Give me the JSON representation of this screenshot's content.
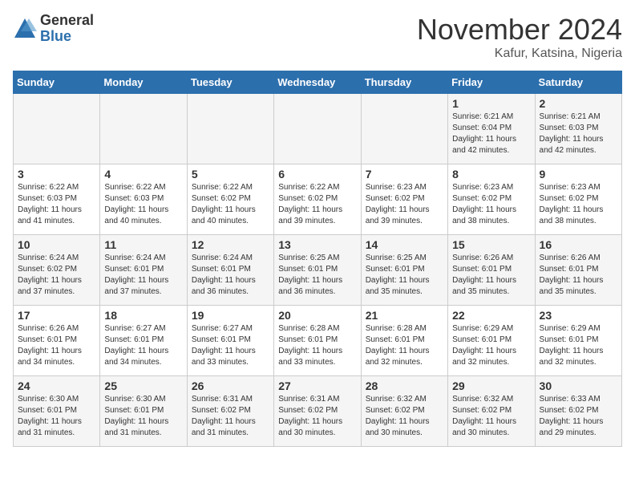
{
  "header": {
    "logo_general": "General",
    "logo_blue": "Blue",
    "month_title": "November 2024",
    "location": "Kafur, Katsina, Nigeria"
  },
  "weekdays": [
    "Sunday",
    "Monday",
    "Tuesday",
    "Wednesday",
    "Thursday",
    "Friday",
    "Saturday"
  ],
  "weeks": [
    [
      {
        "day": "",
        "info": ""
      },
      {
        "day": "",
        "info": ""
      },
      {
        "day": "",
        "info": ""
      },
      {
        "day": "",
        "info": ""
      },
      {
        "day": "",
        "info": ""
      },
      {
        "day": "1",
        "info": "Sunrise: 6:21 AM\nSunset: 6:04 PM\nDaylight: 11 hours and 42 minutes."
      },
      {
        "day": "2",
        "info": "Sunrise: 6:21 AM\nSunset: 6:03 PM\nDaylight: 11 hours and 42 minutes."
      }
    ],
    [
      {
        "day": "3",
        "info": "Sunrise: 6:22 AM\nSunset: 6:03 PM\nDaylight: 11 hours and 41 minutes."
      },
      {
        "day": "4",
        "info": "Sunrise: 6:22 AM\nSunset: 6:03 PM\nDaylight: 11 hours and 40 minutes."
      },
      {
        "day": "5",
        "info": "Sunrise: 6:22 AM\nSunset: 6:02 PM\nDaylight: 11 hours and 40 minutes."
      },
      {
        "day": "6",
        "info": "Sunrise: 6:22 AM\nSunset: 6:02 PM\nDaylight: 11 hours and 39 minutes."
      },
      {
        "day": "7",
        "info": "Sunrise: 6:23 AM\nSunset: 6:02 PM\nDaylight: 11 hours and 39 minutes."
      },
      {
        "day": "8",
        "info": "Sunrise: 6:23 AM\nSunset: 6:02 PM\nDaylight: 11 hours and 38 minutes."
      },
      {
        "day": "9",
        "info": "Sunrise: 6:23 AM\nSunset: 6:02 PM\nDaylight: 11 hours and 38 minutes."
      }
    ],
    [
      {
        "day": "10",
        "info": "Sunrise: 6:24 AM\nSunset: 6:02 PM\nDaylight: 11 hours and 37 minutes."
      },
      {
        "day": "11",
        "info": "Sunrise: 6:24 AM\nSunset: 6:01 PM\nDaylight: 11 hours and 37 minutes."
      },
      {
        "day": "12",
        "info": "Sunrise: 6:24 AM\nSunset: 6:01 PM\nDaylight: 11 hours and 36 minutes."
      },
      {
        "day": "13",
        "info": "Sunrise: 6:25 AM\nSunset: 6:01 PM\nDaylight: 11 hours and 36 minutes."
      },
      {
        "day": "14",
        "info": "Sunrise: 6:25 AM\nSunset: 6:01 PM\nDaylight: 11 hours and 35 minutes."
      },
      {
        "day": "15",
        "info": "Sunrise: 6:26 AM\nSunset: 6:01 PM\nDaylight: 11 hours and 35 minutes."
      },
      {
        "day": "16",
        "info": "Sunrise: 6:26 AM\nSunset: 6:01 PM\nDaylight: 11 hours and 35 minutes."
      }
    ],
    [
      {
        "day": "17",
        "info": "Sunrise: 6:26 AM\nSunset: 6:01 PM\nDaylight: 11 hours and 34 minutes."
      },
      {
        "day": "18",
        "info": "Sunrise: 6:27 AM\nSunset: 6:01 PM\nDaylight: 11 hours and 34 minutes."
      },
      {
        "day": "19",
        "info": "Sunrise: 6:27 AM\nSunset: 6:01 PM\nDaylight: 11 hours and 33 minutes."
      },
      {
        "day": "20",
        "info": "Sunrise: 6:28 AM\nSunset: 6:01 PM\nDaylight: 11 hours and 33 minutes."
      },
      {
        "day": "21",
        "info": "Sunrise: 6:28 AM\nSunset: 6:01 PM\nDaylight: 11 hours and 32 minutes."
      },
      {
        "day": "22",
        "info": "Sunrise: 6:29 AM\nSunset: 6:01 PM\nDaylight: 11 hours and 32 minutes."
      },
      {
        "day": "23",
        "info": "Sunrise: 6:29 AM\nSunset: 6:01 PM\nDaylight: 11 hours and 32 minutes."
      }
    ],
    [
      {
        "day": "24",
        "info": "Sunrise: 6:30 AM\nSunset: 6:01 PM\nDaylight: 11 hours and 31 minutes."
      },
      {
        "day": "25",
        "info": "Sunrise: 6:30 AM\nSunset: 6:01 PM\nDaylight: 11 hours and 31 minutes."
      },
      {
        "day": "26",
        "info": "Sunrise: 6:31 AM\nSunset: 6:02 PM\nDaylight: 11 hours and 31 minutes."
      },
      {
        "day": "27",
        "info": "Sunrise: 6:31 AM\nSunset: 6:02 PM\nDaylight: 11 hours and 30 minutes."
      },
      {
        "day": "28",
        "info": "Sunrise: 6:32 AM\nSunset: 6:02 PM\nDaylight: 11 hours and 30 minutes."
      },
      {
        "day": "29",
        "info": "Sunrise: 6:32 AM\nSunset: 6:02 PM\nDaylight: 11 hours and 30 minutes."
      },
      {
        "day": "30",
        "info": "Sunrise: 6:33 AM\nSunset: 6:02 PM\nDaylight: 11 hours and 29 minutes."
      }
    ]
  ]
}
